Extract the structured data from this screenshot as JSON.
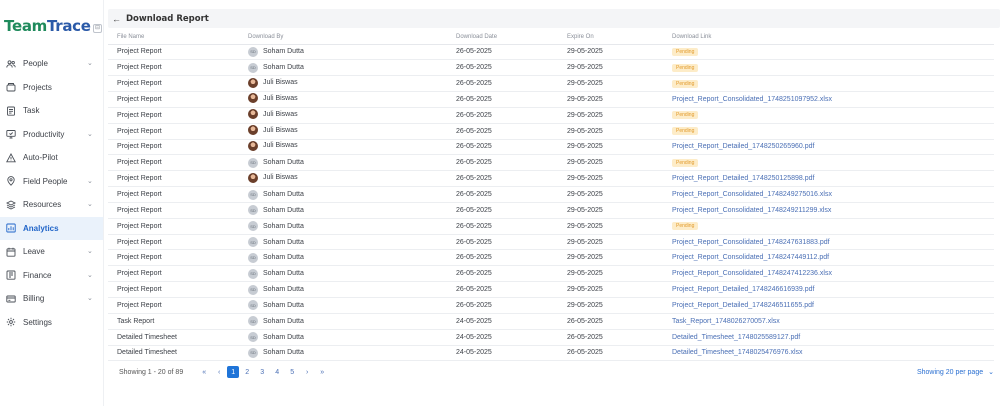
{
  "brand": {
    "part1": "Team",
    "part2": "Trace",
    "collapse_icon": "⊟"
  },
  "sidebar": {
    "items": [
      {
        "label": "People",
        "icon": "people-icon",
        "chevron": true,
        "active": false
      },
      {
        "label": "Projects",
        "icon": "projects-icon",
        "chevron": false,
        "active": false
      },
      {
        "label": "Task",
        "icon": "task-icon",
        "chevron": false,
        "active": false
      },
      {
        "label": "Productivity",
        "icon": "productivity-icon",
        "chevron": true,
        "active": false
      },
      {
        "label": "Auto-Pilot",
        "icon": "autopilot-icon",
        "chevron": false,
        "active": false
      },
      {
        "label": "Field People",
        "icon": "field-people-icon",
        "chevron": true,
        "active": false
      },
      {
        "label": "Resources",
        "icon": "resources-icon",
        "chevron": true,
        "active": false
      },
      {
        "label": "Analytics",
        "icon": "analytics-icon",
        "chevron": false,
        "active": true
      },
      {
        "label": "Leave",
        "icon": "leave-icon",
        "chevron": true,
        "active": false
      },
      {
        "label": "Finance",
        "icon": "finance-icon",
        "chevron": true,
        "active": false
      },
      {
        "label": "Billing",
        "icon": "billing-icon",
        "chevron": true,
        "active": false
      },
      {
        "label": "Settings",
        "icon": "settings-icon",
        "chevron": false,
        "active": false
      }
    ]
  },
  "header": {
    "back_icon": "←",
    "title": "Download Report"
  },
  "table": {
    "columns": [
      "File Name",
      "Download By",
      "Download Date",
      "Expire On",
      "Download Link"
    ],
    "rows": [
      {
        "file": "Project Report",
        "user": "Soham Dutta",
        "avatar": "initials",
        "date": "26-05-2025",
        "expire": "29-05-2025",
        "status": "Pending",
        "link": ""
      },
      {
        "file": "Project Report",
        "user": "Soham Dutta",
        "avatar": "initials",
        "date": "26-05-2025",
        "expire": "29-05-2025",
        "status": "Pending",
        "link": ""
      },
      {
        "file": "Project Report",
        "user": "Juli Biswas",
        "avatar": "photo",
        "date": "26-05-2025",
        "expire": "29-05-2025",
        "status": "Pending",
        "link": ""
      },
      {
        "file": "Project Report",
        "user": "Juli Biswas",
        "avatar": "photo",
        "date": "26-05-2025",
        "expire": "29-05-2025",
        "status": "",
        "link": "Project_Report_Consolidated_1748251097952.xlsx"
      },
      {
        "file": "Project Report",
        "user": "Juli Biswas",
        "avatar": "photo",
        "date": "26-05-2025",
        "expire": "29-05-2025",
        "status": "Pending",
        "link": ""
      },
      {
        "file": "Project Report",
        "user": "Juli Biswas",
        "avatar": "photo",
        "date": "26-05-2025",
        "expire": "29-05-2025",
        "status": "Pending",
        "link": ""
      },
      {
        "file": "Project Report",
        "user": "Juli Biswas",
        "avatar": "photo",
        "date": "26-05-2025",
        "expire": "29-05-2025",
        "status": "",
        "link": "Project_Report_Detailed_1748250265960.pdf"
      },
      {
        "file": "Project Report",
        "user": "Soham Dutta",
        "avatar": "initials",
        "date": "26-05-2025",
        "expire": "29-05-2025",
        "status": "Pending",
        "link": ""
      },
      {
        "file": "Project Report",
        "user": "Juli Biswas",
        "avatar": "photo",
        "date": "26-05-2025",
        "expire": "29-05-2025",
        "status": "",
        "link": "Project_Report_Detailed_1748250125898.pdf"
      },
      {
        "file": "Project Report",
        "user": "Soham Dutta",
        "avatar": "initials",
        "date": "26-05-2025",
        "expire": "29-05-2025",
        "status": "",
        "link": "Project_Report_Consolidated_1748249275016.xlsx"
      },
      {
        "file": "Project Report",
        "user": "Soham Dutta",
        "avatar": "initials",
        "date": "26-05-2025",
        "expire": "29-05-2025",
        "status": "",
        "link": "Project_Report_Consolidated_1748249211299.xlsx"
      },
      {
        "file": "Project Report",
        "user": "Soham Dutta",
        "avatar": "initials",
        "date": "26-05-2025",
        "expire": "29-05-2025",
        "status": "Pending",
        "link": ""
      },
      {
        "file": "Project Report",
        "user": "Soham Dutta",
        "avatar": "initials",
        "date": "26-05-2025",
        "expire": "29-05-2025",
        "status": "",
        "link": "Project_Report_Consolidated_1748247631883.pdf"
      },
      {
        "file": "Project Report",
        "user": "Soham Dutta",
        "avatar": "initials",
        "date": "26-05-2025",
        "expire": "29-05-2025",
        "status": "",
        "link": "Project_Report_Consolidated_1748247449112.pdf"
      },
      {
        "file": "Project Report",
        "user": "Soham Dutta",
        "avatar": "initials",
        "date": "26-05-2025",
        "expire": "29-05-2025",
        "status": "",
        "link": "Project_Report_Consolidated_1748247412236.xlsx"
      },
      {
        "file": "Project Report",
        "user": "Soham Dutta",
        "avatar": "initials",
        "date": "26-05-2025",
        "expire": "29-05-2025",
        "status": "",
        "link": "Project_Report_Detailed_1748246616939.pdf"
      },
      {
        "file": "Project Report",
        "user": "Soham Dutta",
        "avatar": "initials",
        "date": "26-05-2025",
        "expire": "29-05-2025",
        "status": "",
        "link": "Project_Report_Detailed_1748246511655.pdf"
      },
      {
        "file": "Task Report",
        "user": "Soham Dutta",
        "avatar": "initials",
        "date": "24-05-2025",
        "expire": "26-05-2025",
        "status": "",
        "link": "Task_Report_1748026270057.xlsx"
      },
      {
        "file": "Detailed Timesheet",
        "user": "Soham Dutta",
        "avatar": "initials",
        "date": "24-05-2025",
        "expire": "26-05-2025",
        "status": "",
        "link": "Detailed_Timesheet_1748025589127.pdf"
      },
      {
        "file": "Detailed Timesheet",
        "user": "Soham Dutta",
        "avatar": "initials",
        "date": "24-05-2025",
        "expire": "26-05-2025",
        "status": "",
        "link": "Detailed_Timesheet_1748025476976.xlsx"
      }
    ]
  },
  "avatar_initials": "SD",
  "footer": {
    "showing": "Showing 1 - 20 of 89",
    "first": "«",
    "prev": "‹",
    "next": "›",
    "last": "»",
    "pages": [
      "1",
      "2",
      "3",
      "4",
      "5"
    ],
    "current_page": "1",
    "per_page": "Showing 20 per page",
    "per_page_icon": "⌄"
  },
  "colors": {
    "accent": "#1f74d8",
    "brand_green": "#1f8a5c",
    "brand_blue": "#2b5aa8",
    "pending_bg": "#fdecc8",
    "pending_text": "#e29b2d",
    "link": "#4a6fb5"
  }
}
